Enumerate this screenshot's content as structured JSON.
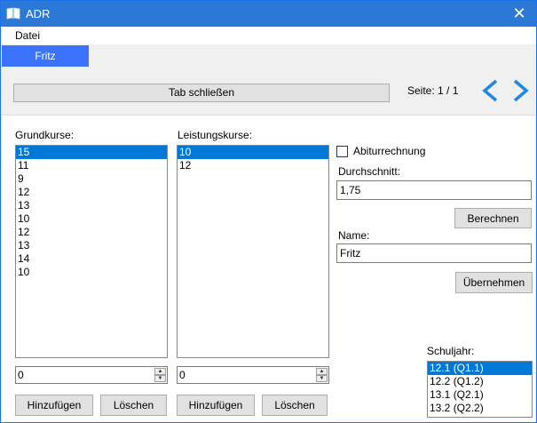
{
  "window": {
    "title": "ADR",
    "close_glyph": "✕",
    "title_color": "#2b78d6"
  },
  "menu": {
    "items": [
      {
        "label": "Datei"
      }
    ]
  },
  "tabs": [
    {
      "label": "Fritz",
      "active": true
    }
  ],
  "toolbar": {
    "close_tab_label": "Tab schließen",
    "page_label": "Seite: 1 / 1",
    "prev_icon": "chevron-left-icon",
    "next_icon": "chevron-right-icon",
    "arrow_color": "#1e88e5"
  },
  "grundkurse": {
    "label": "Grundkurse:",
    "items": [
      "15",
      "11",
      "9",
      "12",
      "13",
      "10",
      "12",
      "13",
      "14",
      "10"
    ],
    "selected_index": 0,
    "spin_value": "0",
    "add_label": "Hinzufügen",
    "delete_label": "Löschen"
  },
  "leistungskurse": {
    "label": "Leistungskurse:",
    "items": [
      "10",
      "12"
    ],
    "selected_index": 0,
    "spin_value": "0",
    "add_label": "Hinzufügen",
    "delete_label": "Löschen"
  },
  "abitur": {
    "checkbox_label": "Abiturrechnung",
    "checked": false,
    "average_label": "Durchschnitt:",
    "average_value": "1,75",
    "compute_label": "Berechnen",
    "name_label": "Name:",
    "name_value": "Fritz",
    "apply_label": "Übernehmen"
  },
  "schuljahr": {
    "label": "Schuljahr:",
    "items": [
      "12.1 (Q1.1)",
      "12.2 (Q1.2)",
      "13.1 (Q2.1)",
      "13.2 (Q2.2)"
    ],
    "selected_index": 0
  },
  "colors": {
    "selection": "#0078d7",
    "active_tab": "#3b73ff"
  }
}
